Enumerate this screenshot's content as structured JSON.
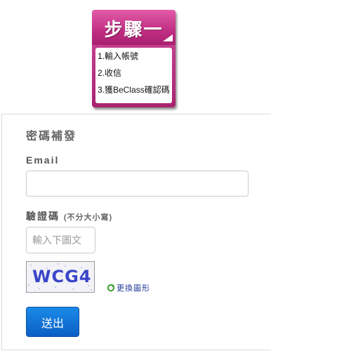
{
  "step": {
    "title": "步驟一",
    "lines": [
      "1.輸入帳號",
      "2.收信",
      "3.獲BeClass確認碼"
    ]
  },
  "form": {
    "title": "密碼補發",
    "email_label": "Email",
    "email_value": "",
    "captcha_label": "驗證碼",
    "captcha_hint": "(不分大小寫)",
    "captcha_placeholder": "輸入下圖文",
    "captcha_image_text": "WCG4",
    "refresh_label": "更換圖形",
    "submit_label": "送出"
  },
  "colors": {
    "badge": "#c02e82",
    "captcha_text": "#3a45c8",
    "button": "#1a78dc",
    "link": "#1f3b9a"
  }
}
